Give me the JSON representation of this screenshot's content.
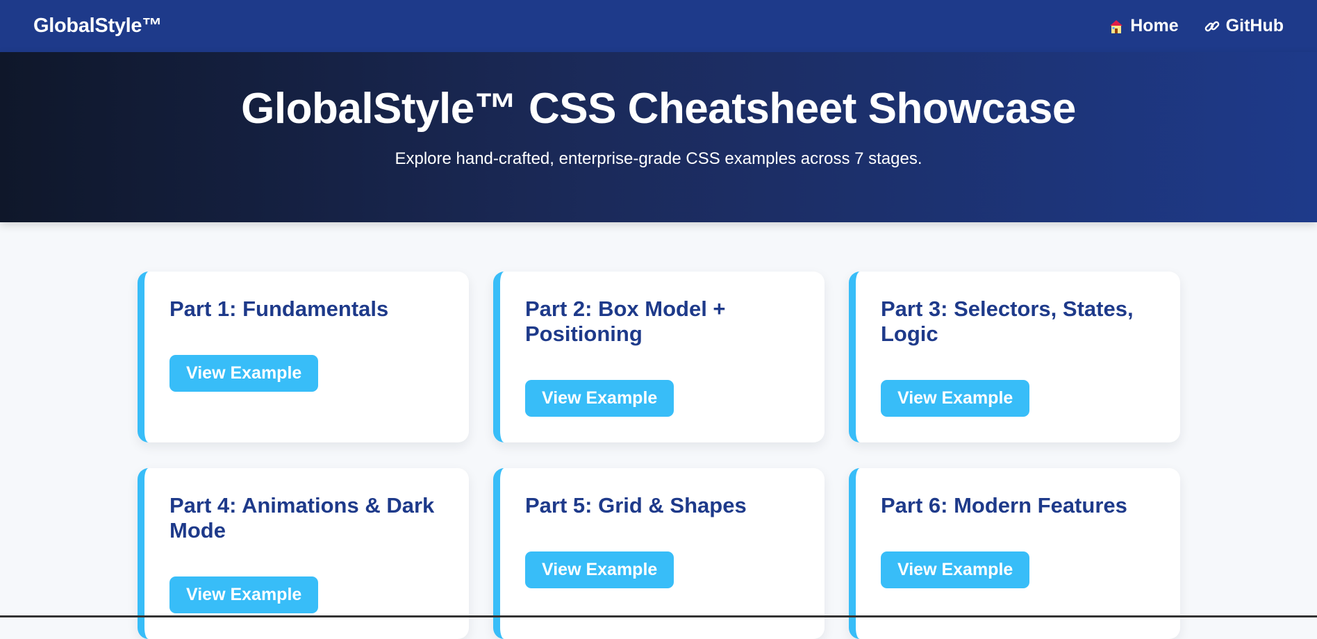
{
  "navbar": {
    "brand": "GlobalStyle™",
    "links": [
      {
        "label": "Home",
        "icon": "house-icon"
      },
      {
        "label": "GitHub",
        "icon": "link-icon"
      }
    ]
  },
  "hero": {
    "title": "GlobalStyle™ CSS Cheatsheet Showcase",
    "subtitle": "Explore hand-crafted, enterprise-grade CSS examples across 7 stages."
  },
  "cards": [
    {
      "title": "Part 1: Fundamentals",
      "button": "View Example"
    },
    {
      "title": "Part 2: Box Model + Positioning",
      "button": "View Example"
    },
    {
      "title": "Part 3: Selectors, States, Logic",
      "button": "View Example"
    },
    {
      "title": "Part 4: Animations & Dark Mode",
      "button": "View Example"
    },
    {
      "title": "Part 5: Grid & Shapes",
      "button": "View Example"
    },
    {
      "title": "Part 6: Modern Features",
      "button": "View Example"
    }
  ],
  "colors": {
    "navbar": "#1e3a8a",
    "accent": "#38bdf8",
    "title": "#1e3a8a",
    "background": "#f6f8fb"
  }
}
